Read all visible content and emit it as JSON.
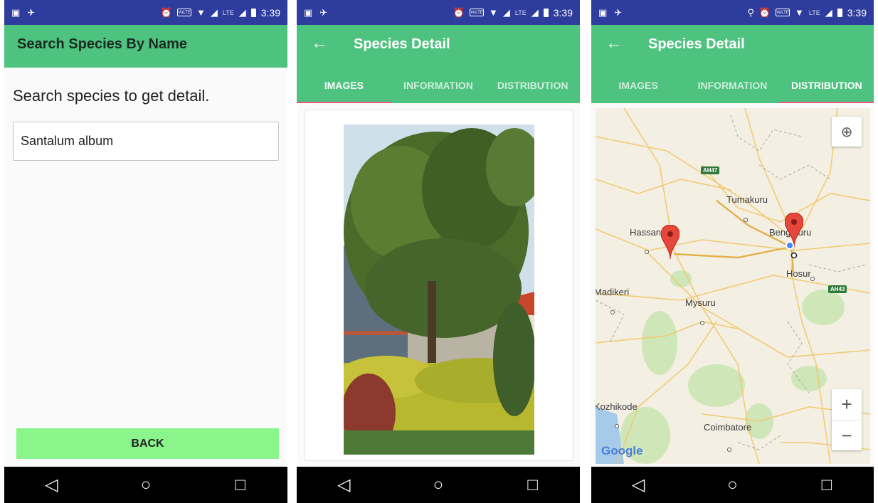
{
  "statusbar": {
    "time": "3:39",
    "volte": "VoLTE",
    "lte": "LTE"
  },
  "colors": {
    "statusbar": "#2e3c9e",
    "appbar": "#4ec27f",
    "tab_indicator": "#e8577a",
    "back_button": "#8af58a"
  },
  "screen1": {
    "title": "Search Species By Name",
    "prompt": "Search species to get detail.",
    "search": {
      "value": "Santalum album"
    },
    "back_label": "BACK"
  },
  "screen2": {
    "title": "Species Detail",
    "tabs": [
      {
        "label": "IMAGES"
      },
      {
        "label": "INFORMATION"
      },
      {
        "label": "DISTRIBUTION"
      }
    ],
    "active_tab": "IMAGES"
  },
  "screen3": {
    "title": "Species Detail",
    "tabs": [
      {
        "label": "IMAGES"
      },
      {
        "label": "INFORMATION"
      },
      {
        "label": "DISTRIBUTION"
      }
    ],
    "active_tab": "DISTRIBUTION",
    "map": {
      "places": [
        "Tumakuru",
        "Hassan",
        "Bengaluru",
        "Hosur",
        "Madikeri",
        "Mysuru",
        "Kozhikode",
        "Coimbatore"
      ],
      "road_badges": [
        "AH47",
        "AH43"
      ],
      "zoom_in": "+",
      "zoom_out": "−",
      "attribution": "Google"
    }
  },
  "icons": {
    "back": "arrow-left-icon",
    "nav": [
      "nav-back-icon",
      "nav-home-icon",
      "nav-recents-icon"
    ],
    "locate": "my-location-icon",
    "pin": "map-pin-icon"
  }
}
